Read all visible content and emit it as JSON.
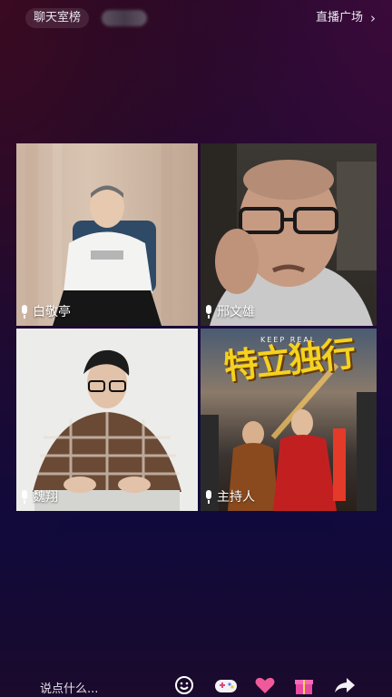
{
  "header": {
    "rank_label": "聊天室榜",
    "plaza_label": "直播广场"
  },
  "participants": [
    {
      "name": "白敬亭"
    },
    {
      "name": "邢文雄"
    },
    {
      "name": "魏翔"
    },
    {
      "name": "主持人"
    }
  ],
  "poster": {
    "title": "特立独行",
    "subtitle": "KEEP REAL"
  },
  "bottom": {
    "input_placeholder": "说点什么..."
  },
  "icons": [
    "chevron-right-icon",
    "mic-icon",
    "smiley-icon",
    "game-controller-icon",
    "heart-gift-icon",
    "gift-box-icon",
    "share-icon"
  ]
}
